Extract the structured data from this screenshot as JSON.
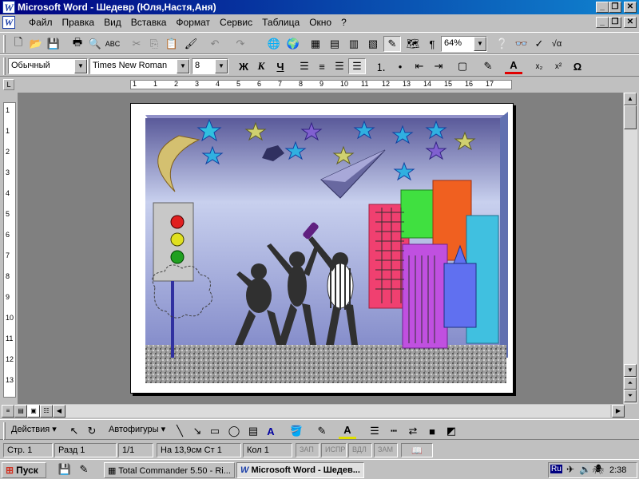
{
  "window": {
    "title": "Microsoft Word - Шедевр (Юля,Настя,Аня)",
    "app_icon": "word-icon",
    "controls": [
      "_",
      "❐",
      "✕"
    ]
  },
  "menu": [
    "Файл",
    "Правка",
    "Вид",
    "Вставка",
    "Формат",
    "Сервис",
    "Таблица",
    "Окно",
    "?"
  ],
  "standard_toolbar": {
    "zoom": "64%",
    "icons": [
      "new-icon",
      "open-icon",
      "save-icon",
      "print-icon",
      "print-preview-icon",
      "spelling-icon",
      "cut-icon",
      "copy-icon",
      "paste-icon",
      "format-painter-icon",
      "undo-icon",
      "redo-icon",
      "hyperlink-icon",
      "web-toolbar-icon",
      "tables-borders-icon",
      "insert-table-icon",
      "insert-excel-icon",
      "columns-icon",
      "drawing-icon",
      "document-map-icon",
      "show-hide-icon",
      "help-icon",
      "binoculars-icon",
      "equation-icon"
    ]
  },
  "format_toolbar": {
    "style": "Обычный",
    "font": "Times New Roman",
    "size": "8",
    "bold": "Ж",
    "italic": "К",
    "underline": "Ч"
  },
  "ruler": {
    "labels": [
      "1",
      "1",
      "2",
      "3",
      "4",
      "5",
      "6",
      "7",
      "8",
      "9",
      "10",
      "11",
      "12",
      "13",
      "14",
      "15",
      "16",
      "17"
    ]
  },
  "vruler": {
    "labels": [
      "1",
      "1",
      "2",
      "3",
      "4",
      "5",
      "6",
      "7",
      "8",
      "9",
      "10",
      "11",
      "12",
      "13"
    ]
  },
  "drawing_toolbar": {
    "actions": "Действия",
    "autoshapes": "Автофигуры"
  },
  "status": {
    "page": "Стр.",
    "page_num": "1",
    "section": "Разд",
    "section_num": "1",
    "pages": "1/1",
    "at": "На 13,9см",
    "line": "Ст",
    "line_num": "1",
    "col": "Кол",
    "col_num": "1",
    "rec": "ЗАП",
    "trk": "ИСПР",
    "ext": "ВДЛ",
    "ovr": "ЗАМ"
  },
  "taskbar": {
    "start": "Пуск",
    "task1": "Total Commander 5.50 - Ri...",
    "task2": "Microsoft Word - Шедев...",
    "lang": "Ru",
    "time": "2:38"
  },
  "colors": {
    "title_start": "#000080",
    "title_end": "#1084d0",
    "chrome": "#c0c0c0",
    "workspace": "#808080"
  }
}
